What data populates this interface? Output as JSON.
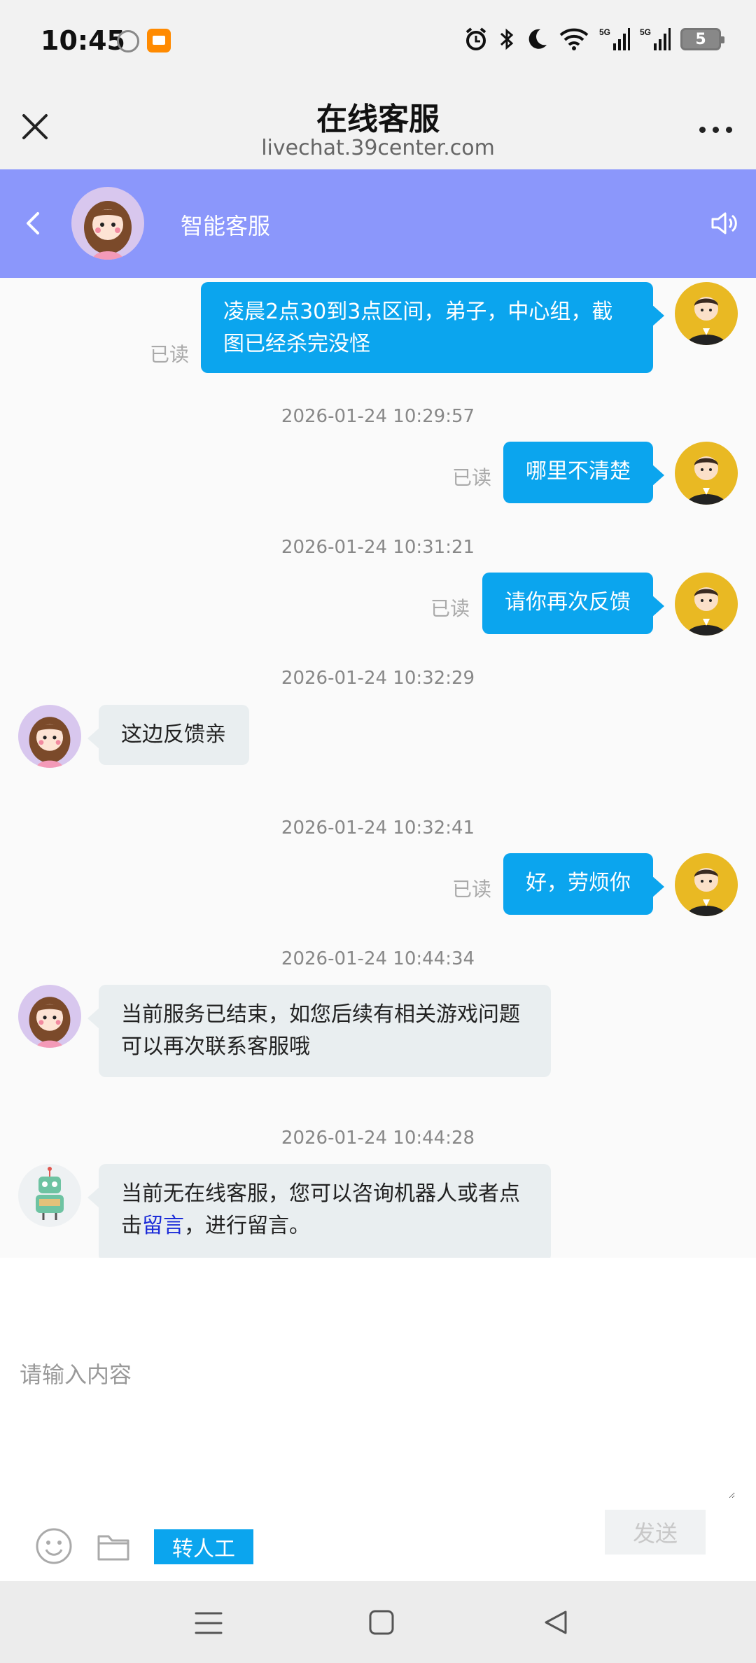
{
  "status_bar": {
    "time": "10:45",
    "battery": "5"
  },
  "header": {
    "title": "在线客服",
    "url": "livechat.39center.com"
  },
  "chat_header": {
    "agent_name": "智能客服"
  },
  "messages": [
    {
      "sender": "me",
      "text_line1": "凌晨2点30到3点区间，弟子，中心组，截",
      "text_line2": "图已经杀完没怪",
      "status": "已读"
    },
    {
      "timestamp": "2026-01-24 10:29:57",
      "sender": "me",
      "text": "哪里不清楚",
      "status": "已读"
    },
    {
      "timestamp": "2026-01-24 10:31:21",
      "sender": "me",
      "text": "请你再次反馈",
      "status": "已读"
    },
    {
      "timestamp": "2026-01-24 10:32:29",
      "sender": "agent",
      "text": "这边反馈亲"
    },
    {
      "timestamp": "2026-01-24 10:32:41",
      "sender": "me",
      "text": "好，劳烦你",
      "status": "已读"
    },
    {
      "timestamp": "2026-01-24 10:44:34",
      "sender": "agent",
      "text_line1": "当前服务已结束，如您后续有相关游戏问题",
      "text_line2": "可以再次联系客服哦"
    },
    {
      "timestamp": "2026-01-24 10:44:28",
      "sender": "bot",
      "text_line1": "当前无在线客服，您可以咨询机器人或者点",
      "text_line2_prefix": "击",
      "link": "留言",
      "text_line2_suffix": "，进行留言。"
    }
  ],
  "input": {
    "placeholder": "请输入内容",
    "human_label": "转人工",
    "send_label": "发送"
  },
  "colors": {
    "accent": "#0ba5ee",
    "chat_header": "#8b97fb",
    "link": "#1b2bd8"
  },
  "icons": [
    "close-icon",
    "more-icon",
    "back-icon",
    "speaker-icon",
    "emoji-icon",
    "folder-icon",
    "menu-icon",
    "home-icon",
    "nav-back-icon"
  ]
}
